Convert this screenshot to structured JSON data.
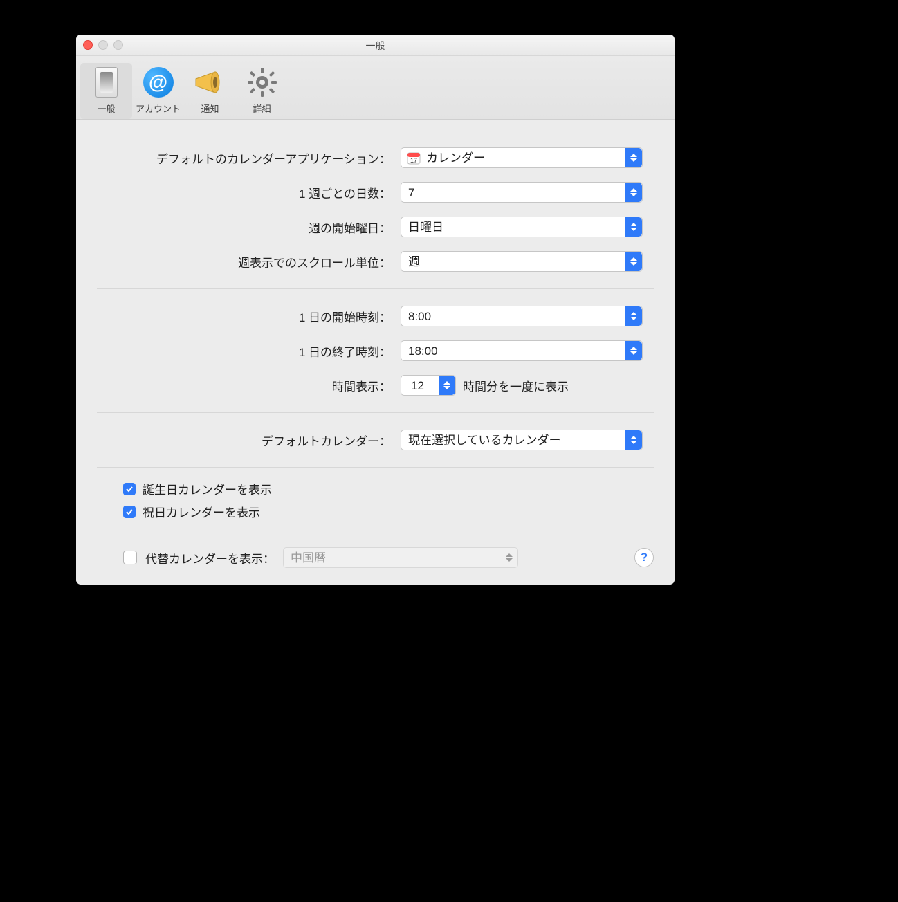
{
  "window": {
    "title": "一般"
  },
  "toolbar": {
    "items": [
      {
        "label": "一般"
      },
      {
        "label": "アカウント"
      },
      {
        "label": "通知"
      },
      {
        "label": "詳細"
      }
    ]
  },
  "rows": {
    "default_app": {
      "label": "デフォルトのカレンダーアプリケーション：",
      "value": "カレンダー"
    },
    "days_per_week": {
      "label": "1 週ごとの日数：",
      "value": "7"
    },
    "week_start": {
      "label": "週の開始曜日：",
      "value": "日曜日"
    },
    "scroll_unit": {
      "label": "週表示でのスクロール単位：",
      "value": "週"
    },
    "day_start": {
      "label": "1 日の開始時刻：",
      "value": "8:00"
    },
    "day_end": {
      "label": "1 日の終了時刻：",
      "value": "18:00"
    },
    "hours_shown": {
      "label": "時間表示：",
      "value": "12",
      "suffix": "時間分を一度に表示"
    },
    "default_calendar": {
      "label": "デフォルトカレンダー：",
      "value": "現在選択しているカレンダー"
    }
  },
  "checks": {
    "birthday": {
      "label": "誕生日カレンダーを表示"
    },
    "holiday": {
      "label": "祝日カレンダーを表示"
    }
  },
  "alt": {
    "label": "代替カレンダーを表示：",
    "value": "中国暦"
  },
  "help": {
    "glyph": "?"
  }
}
